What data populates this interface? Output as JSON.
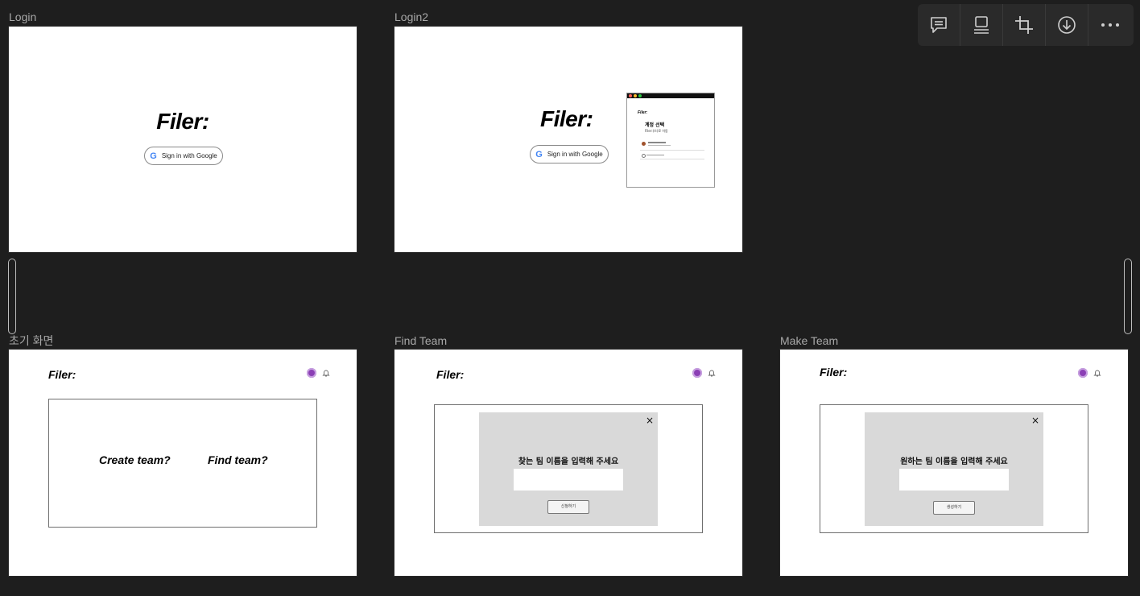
{
  "frames": {
    "login": {
      "label": "Login",
      "logo": "Filer:",
      "google_button": "Sign in with Google",
      "google_glyph": "G"
    },
    "login2": {
      "label": "Login2",
      "logo": "Filer:",
      "google_button": "Sign in with Google",
      "google_glyph": "G",
      "popup": {
        "logo": "Filer:",
        "title": "계정 선택",
        "subtitle": "Filer:(으)로 이동"
      }
    },
    "initial": {
      "label": "초기 화면",
      "logo": "Filer:",
      "create_team": "Create team?",
      "find_team": "Find team?"
    },
    "find_team": {
      "label": "Find Team",
      "logo": "Filer:",
      "modal_title": "찾는 팀 이름을 입력해 주세요",
      "button": "신청하기",
      "close": "×"
    },
    "make_team": {
      "label": "Make Team",
      "logo": "Filer:",
      "modal_title": "원하는 팀 이름을 입력해 주세요",
      "button": "생성하기",
      "close": "×"
    }
  },
  "toolbar": {
    "items": [
      "comment-icon",
      "frame-icon",
      "crop-icon",
      "download-icon",
      "more-icon"
    ]
  },
  "colors": {
    "background": "#1e1e1e",
    "modal_gray": "#d9d9d9",
    "avatar": "#8b3fb5"
  }
}
